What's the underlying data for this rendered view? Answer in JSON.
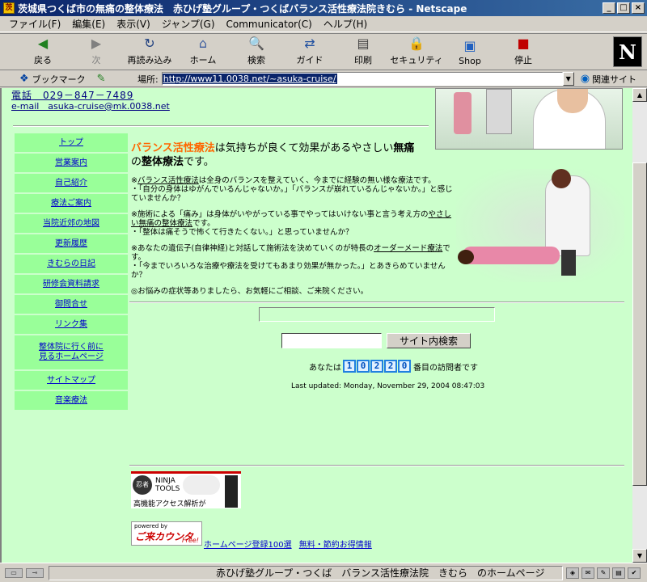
{
  "window": {
    "title": "茨城県つくば市の無痛の整体療法　赤ひげ塾グループ・つくばバランス活性療法院きむら - Netscape",
    "icon": "netscape-app-icon"
  },
  "menu": [
    "ファイル(F)",
    "編集(E)",
    "表示(V)",
    "ジャンプ(G)",
    "Communicator(C)",
    "ヘルプ(H)"
  ],
  "toolbar": [
    {
      "label": "戻る",
      "icon": "back-arrow-icon",
      "glyph": "◀",
      "color": "#208020",
      "disabled": false
    },
    {
      "label": "次",
      "icon": "forward-arrow-icon",
      "glyph": "▶",
      "color": "#808080",
      "disabled": true
    },
    {
      "label": "再読み込み",
      "icon": "reload-icon",
      "glyph": "↻",
      "color": "#204080",
      "disabled": false
    },
    {
      "label": "ホーム",
      "icon": "home-icon",
      "glyph": "⌂",
      "color": "#4060a0",
      "disabled": false
    },
    {
      "label": "検索",
      "icon": "search-icon",
      "glyph": "🔍",
      "color": "#606000",
      "disabled": false
    },
    {
      "label": "ガイド",
      "icon": "guide-icon",
      "glyph": "⇄",
      "color": "#2050a0",
      "disabled": false
    },
    {
      "label": "印刷",
      "icon": "print-icon",
      "glyph": "▤",
      "color": "#404040",
      "disabled": false
    },
    {
      "label": "セキュリティ",
      "icon": "lock-icon",
      "glyph": "🔒",
      "color": "#a06000",
      "disabled": false
    },
    {
      "label": "Shop",
      "icon": "shop-icon",
      "glyph": "▣",
      "color": "#2060c0",
      "disabled": false
    },
    {
      "label": "停止",
      "icon": "stop-icon",
      "glyph": "■",
      "color": "#c00000",
      "disabled": false
    }
  ],
  "brand_logo": "N",
  "location": {
    "bookmark_label": "ブックマーク",
    "label": "場所:",
    "url": "http://www11.0038.net/~asuka-cruise/",
    "related_label": "関連サイト"
  },
  "contact": {
    "phone": "電話　029－847－7489",
    "email": "e-mail　asuka-cruise@mk.0038.net"
  },
  "nav": [
    {
      "label": "トップ",
      "tall": false
    },
    {
      "label": "営業案内",
      "tall": false
    },
    {
      "label": "自己紹介",
      "tall": false
    },
    {
      "label": "療法ご案内",
      "tall": false
    },
    {
      "label": "当院近郊の地図",
      "tall": false
    },
    {
      "label": "更新履歴",
      "tall": false
    },
    {
      "label": "きむらの日記",
      "tall": false
    },
    {
      "label": "研修会資料請求",
      "tall": false
    },
    {
      "label": "御問合せ",
      "tall": false
    },
    {
      "label": "リンク集",
      "tall": false
    },
    {
      "label": "整体院に行く前に\n見るホームページ",
      "tall": true
    },
    {
      "label": "サイトマップ",
      "tall": false
    },
    {
      "label": "音楽療法",
      "tall": false
    }
  ],
  "headline": {
    "accent": "バランス活性療法",
    "text1": "は気持ちが良くて効果があるやさしい",
    "bold1": "無痛",
    "text2": "の",
    "bold2": "整体療法",
    "text3": "です。"
  },
  "paragraphs": [
    {
      "parts": [
        {
          "t": "※",
          "u": false
        },
        {
          "t": "バランス活性療法",
          "u": true
        },
        {
          "t": "は全身のバランスを整えていく、今までに経験の無い様な療法です。",
          "u": false
        },
        {
          "t": "\n・「自分の身体はゆがんでいるんじゃないか。」「バランスが崩れているんじゃないか。」と感じていませんか？",
          "u": false
        }
      ]
    },
    {
      "parts": [
        {
          "t": "※施術による「痛み」は身体がいやがっている事でやってはいけない事と言う考え方の",
          "u": false
        },
        {
          "t": "やさしい無痛の整体療法",
          "u": true
        },
        {
          "t": "です。\n・「整体は痛そうで怖くて行きたくない。」と思っていませんか？",
          "u": false
        }
      ]
    },
    {
      "parts": [
        {
          "t": "※あなたの遺伝子(自律神経)と対話して施術法を決めていくのが特長の",
          "u": false
        },
        {
          "t": "オーダーメード療法",
          "u": true
        },
        {
          "t": "です。\n・「今までいろいろな治療や療法を受けてもあまり効果が無かった。」とあきらめていませんか？",
          "u": false
        }
      ]
    },
    {
      "parts": [
        {
          "t": "◎お悩みの症状等ありましたら、お気軽にご相談、ご来院ください。",
          "u": false
        }
      ]
    }
  ],
  "search": {
    "button_label": "サイト内検索",
    "value": ""
  },
  "counter": {
    "prefix": "あなたは",
    "digits": [
      "1",
      "0",
      "2",
      "2",
      "0"
    ],
    "suffix": "番目の訪問者です"
  },
  "updated": "Last updated: Monday, November 29, 2004 08:47:03",
  "ninja": {
    "logo": "忍者",
    "brand": "NINJA\nTOOLS",
    "caption": "高機能アクセス解析が"
  },
  "counter_badge": {
    "powered": "powered by",
    "name": "ご来カウンター",
    "free": "Free!"
  },
  "footer_links": [
    "ホームページ登録100選",
    "無料・節約お得情報"
  ],
  "status": {
    "text": "赤ひげ塾グループ・つくば　バランス活性療法院　きむら　のホームページ"
  }
}
